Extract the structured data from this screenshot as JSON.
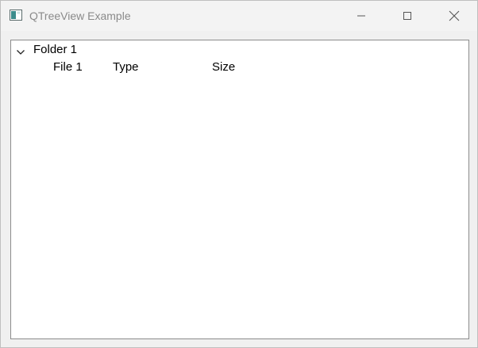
{
  "window": {
    "title": "QTreeView Example",
    "controls": {
      "minimize_icon": "minimize-icon",
      "maximize_icon": "maximize-icon",
      "close_icon": "close-icon"
    },
    "app_icon": "qt-window-icon"
  },
  "tree": {
    "folder": {
      "label": "Folder 1",
      "expanded": true,
      "expander_icon": "chevron-down-icon"
    },
    "rows": [
      {
        "name": "File 1",
        "type": "Type",
        "size": "Size"
      }
    ]
  },
  "colors": {
    "titlebar_bg": "#f3f3f3",
    "title_text": "#8a8a8a",
    "tree_bg": "#ffffff",
    "tree_border": "#8c8c8c",
    "text": "#000000"
  }
}
